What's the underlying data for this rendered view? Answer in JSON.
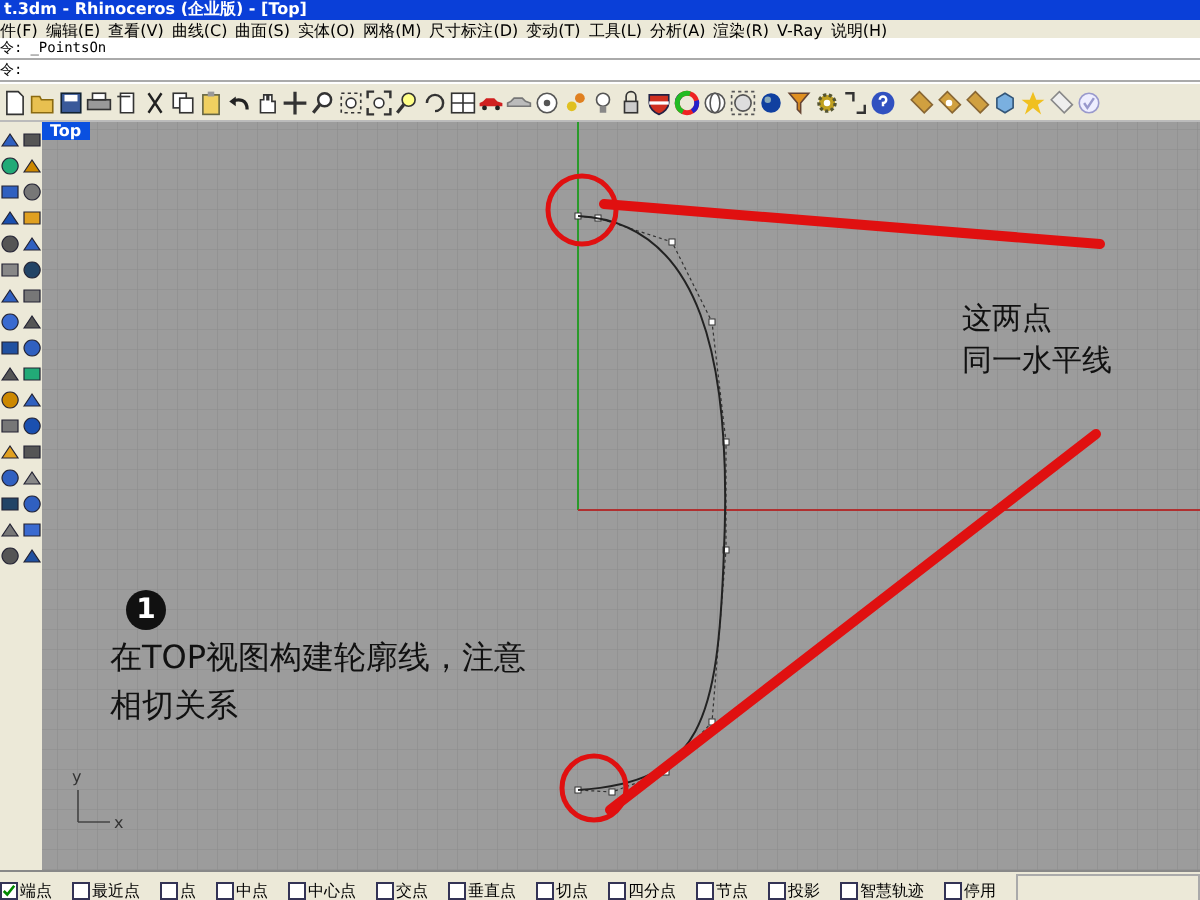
{
  "window": {
    "title": "t.3dm - Rhinoceros (企业版) - [Top]"
  },
  "menu": [
    "件(F)",
    "编辑(E)",
    "查看(V)",
    "曲线(C)",
    "曲面(S)",
    "实体(O)",
    "网格(M)",
    "尺寸标注(D)",
    "变动(T)",
    "工具(L)",
    "分析(A)",
    "渲染(R)",
    "V-Ray",
    "说明(H)"
  ],
  "command_lines": [
    {
      "prompt": "令:",
      "value": "_PointsOn"
    },
    {
      "prompt": "令:"
    }
  ],
  "viewport": {
    "title": "Top",
    "note": [
      "这两点",
      "同一水平线"
    ],
    "step": {
      "number": "1",
      "lines": [
        "在TOP视图构建轮廓线，注意",
        "相切关系"
      ]
    },
    "axis_labels": {
      "y": "y",
      "x": "x"
    }
  },
  "osnaps": [
    {
      "label": "端点",
      "checked": true
    },
    {
      "label": "最近点",
      "checked": false
    },
    {
      "label": "点",
      "checked": false
    },
    {
      "label": "中点",
      "checked": false
    },
    {
      "label": "中心点",
      "checked": false
    },
    {
      "label": "交点",
      "checked": false
    },
    {
      "label": "垂直点",
      "checked": false
    },
    {
      "label": "切点",
      "checked": false
    },
    {
      "label": "四分点",
      "checked": false
    },
    {
      "label": "节点",
      "checked": false
    },
    {
      "label": "投影",
      "checked": false
    },
    {
      "label": "智慧轨迹",
      "checked": false
    },
    {
      "label": "停用",
      "checked": false
    }
  ]
}
